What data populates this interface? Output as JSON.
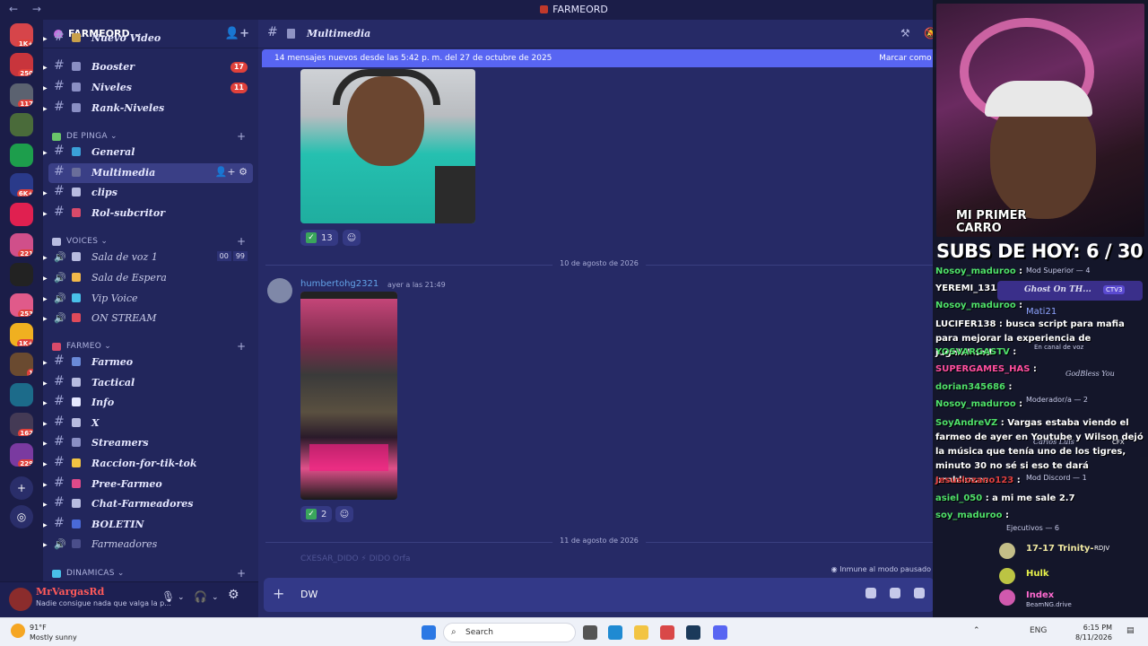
{
  "titlebar": {
    "title": "FARMEORD",
    "nav_back": "←",
    "nav_fwd": "→"
  },
  "rail": {
    "servers": [
      {
        "badge": "1K+",
        "color": "#d6454a"
      },
      {
        "badge": "250",
        "color": "#c8353c"
      },
      {
        "badge": "117",
        "color": "#5b6270"
      },
      {
        "badge": "",
        "color": "#4a6b3a"
      },
      {
        "badge": "",
        "color": "#1d9e4c"
      },
      {
        "badge": "6K+",
        "color": "#2a3a8a"
      },
      {
        "badge": "",
        "color": "#e02050"
      },
      {
        "badge": "221",
        "color": "#d04f8a"
      },
      {
        "badge": "",
        "color": "#222"
      },
      {
        "badge": "253",
        "color": "#e05a8a"
      },
      {
        "badge": "1K+",
        "color": "#f0b020"
      },
      {
        "badge": "1",
        "color": "#6a4a30"
      },
      {
        "badge": "",
        "color": "#1c6b8a"
      },
      {
        "badge": "162",
        "color": "#443a55"
      },
      {
        "badge": "229",
        "color": "#7a3aa0"
      }
    ],
    "add_icon": "+",
    "explore_icon": "compass-icon"
  },
  "guild": {
    "name": "FARMEORD ⌄"
  },
  "channels": [
    {
      "name": "Nuevo Video",
      "count": "",
      "emo": "#c8a04a",
      "kind": "text"
    },
    {
      "name": "Booster",
      "count": "17",
      "emo": "#8a8fc4",
      "kind": "text"
    },
    {
      "name": "Niveles",
      "count": "11",
      "emo": "#8a8fc4",
      "kind": "text"
    },
    {
      "name": "Rank-Niveles",
      "count": "",
      "emo": "#8a8fc4",
      "kind": "text"
    }
  ],
  "cat_depinga": {
    "label": "DE PINGA ⌄"
  },
  "channels2": [
    {
      "name": "General",
      "emo": "#3aa0d8"
    },
    {
      "name": "Multimedia",
      "emo": "#6a6e9a"
    },
    {
      "name": "clips",
      "emo": "#b8bce0"
    },
    {
      "name": "Rol-subcritor",
      "emo": "#d84a6a"
    }
  ],
  "cat_voices": {
    "label": "VOICES ⌄"
  },
  "voice": [
    {
      "name": "Sala de voz 1",
      "c1": "00",
      "c2": "99"
    },
    {
      "name": "Sala de Espera"
    },
    {
      "name": "Vip Voice"
    },
    {
      "name": "ON STREAM"
    }
  ],
  "cat_farmeo": {
    "label": "FARMEO ⌄"
  },
  "channels3": [
    {
      "name": "Farmeo"
    },
    {
      "name": "Tactical"
    },
    {
      "name": "Info"
    },
    {
      "name": "X"
    },
    {
      "name": "Streamers"
    },
    {
      "name": "Raccion-for-tik-tok"
    },
    {
      "name": "Pree-Farmeo"
    },
    {
      "name": "Chat-Farmeadores"
    },
    {
      "name": "BOLETIN"
    },
    {
      "name": "Farmeadores"
    }
  ],
  "cat_dinamicas": {
    "label": "DINAMICAS ⌄"
  },
  "user": {
    "name": "MrVargasRd",
    "status": "Nadie consigue nada que valga la p..."
  },
  "header": {
    "title": "Multimedia"
  },
  "newbar": {
    "text": "14 mensajes nuevos desde las 5:42 p. m. del 27 de octubre de 2025",
    "mark": "Marcar como l"
  },
  "reactions": {
    "first": "13",
    "second": "2"
  },
  "dividers": {
    "d1": "10 de agosto de 2026",
    "d2": "11 de agosto de 2026"
  },
  "message": {
    "author": "humbertohg2321",
    "time": "ayer a las 21:49"
  },
  "ghost": {
    "text": "CXESAR_DIDO   ⚡ DIDO   Orfa"
  },
  "paused": "Inmune al modo pausado",
  "input": {
    "value": "DW"
  },
  "overlay": {
    "cam_caption": "MI PRIMER\nCARRO",
    "subs": "SUBS DE HOY: 6 / 30",
    "chat": [
      {
        "user": "Nosoy_maduroo",
        "color": "#4fe06a",
        "text": ":"
      },
      {
        "user": "YEREMI_1313",
        "color": "#ffffff",
        "text": ":"
      },
      {
        "user": "Nosoy_maduroo",
        "color": "#4fe06a",
        "text": ":"
      },
      {
        "user": "LUCIFER138",
        "color": "#ffffff",
        "text": ": busca script para mafia para mejorar la experiencia de jugabilidad"
      },
      {
        "user": "YOSVARGASTV",
        "color": "#4fe06a",
        "text": ":"
      },
      {
        "user": "SUPERGAMES_HAS",
        "color": "#ff4fa0",
        "text": ":"
      },
      {
        "user": "dorian345686",
        "color": "#4fe06a",
        "text": ":"
      },
      {
        "user": "Nosoy_maduroo",
        "color": "#4fe06a",
        "text": ":"
      },
      {
        "user": "SoyAndreVZ",
        "color": "#4fe06a",
        "text": ": Vargas estaba viendo el farmeo de ayer en Youtube y Wilson dejó la música que tenía uno de los tigres, minuto 30 no sé si eso te dará problemas"
      },
      {
        "user": "Jesuslozano123",
        "color": "#e04040",
        "text": ":"
      },
      {
        "user": "asiel_050",
        "color": "#4fe06a",
        "text": ": a mi me sale 2.7"
      },
      {
        "user": "soy_maduroo",
        "color": "#4fe06a",
        "text": ":"
      }
    ],
    "members": {
      "mod_superior": "Mod Superior — 4",
      "ghost_on": "Ghost On TH...",
      "ghost_tag": "CTV3",
      "mati": "Mati21",
      "en_canal": "En canal de voz",
      "godbless": "GodBless You",
      "moderador": "Moderador/a — 2",
      "carlos": "Carlos Luis",
      "carlos_tag": "CFX",
      "mod_discord": "Mod Discord — 1",
      "ejecutivos": "Ejecutivos — 6",
      "trinity": "17-17 Trinity-",
      "trinity_tag": "RDJV",
      "hulk": "Hulk",
      "index": "Index",
      "index_sub": "BeamNG.drive"
    }
  },
  "taskbar": {
    "temp": "91°F",
    "weather": "Mostly sunny",
    "search": "Search",
    "lang": "ENG",
    "time": "6:15 PM",
    "date": "8/11/2026"
  }
}
